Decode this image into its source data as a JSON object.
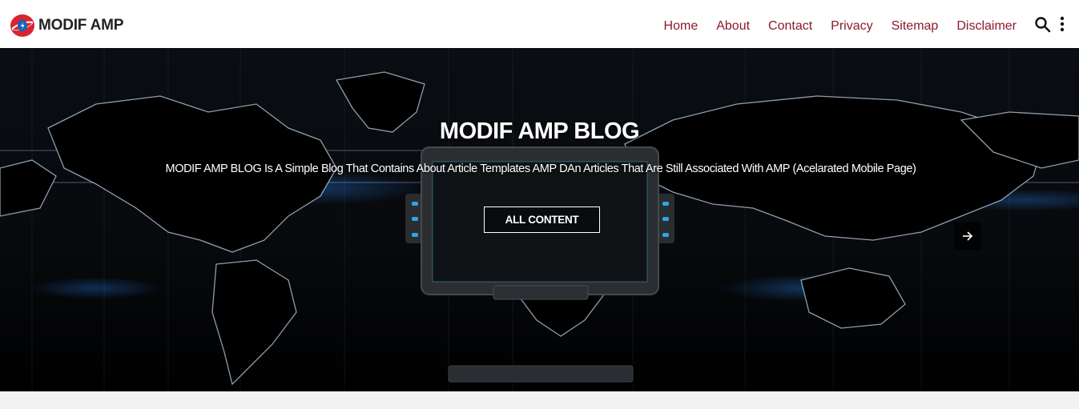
{
  "header": {
    "logo_text": "MODIF AMP",
    "nav": [
      {
        "label": "Home"
      },
      {
        "label": "About"
      },
      {
        "label": "Contact"
      },
      {
        "label": "Privacy"
      },
      {
        "label": "Sitemap"
      },
      {
        "label": "Disclaimer"
      }
    ],
    "icons": {
      "search": "search-icon",
      "more": "more-vertical-icon"
    }
  },
  "hero": {
    "title": "MODIF AMP BLOG",
    "description": "MODIF AMP BLOG Is A Simple Blog That Contains About Article Templates AMP DAn Articles That Are Still Associated With AMP (Acelarated Mobile Page)",
    "cta_label": "ALL CONTENT",
    "next_icon": "arrow-right-icon"
  },
  "colors": {
    "nav_link": "#8b1a2b",
    "logo_red": "#d9232e",
    "logo_blue": "#1c5fb8",
    "page_bg": "#f2f2f2"
  }
}
